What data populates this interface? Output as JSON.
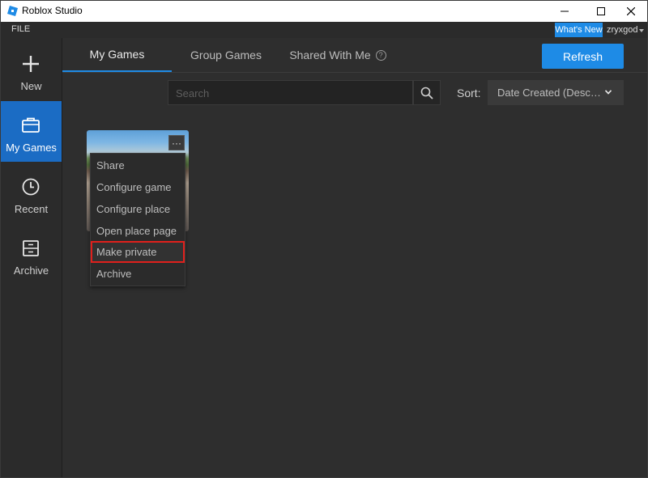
{
  "window": {
    "title": "Roblox Studio"
  },
  "menubar": {
    "file_label": "FILE",
    "whats_new_label": "What's New",
    "username": "zryxgod"
  },
  "sidebar": {
    "items": [
      {
        "label": "New"
      },
      {
        "label": "My Games"
      },
      {
        "label": "Recent"
      },
      {
        "label": "Archive"
      }
    ]
  },
  "tabs": [
    {
      "label": "My Games"
    },
    {
      "label": "Group Games"
    },
    {
      "label": "Shared With Me"
    }
  ],
  "toolbar": {
    "refresh_label": "Refresh"
  },
  "search": {
    "placeholder": "Search"
  },
  "sort": {
    "label": "Sort:",
    "selected": "Date Created (Descending)"
  },
  "card": {
    "more_label": "···"
  },
  "context_menu": {
    "items": [
      {
        "label": "Share"
      },
      {
        "label": "Configure game"
      },
      {
        "label": "Configure place"
      },
      {
        "label": "Open place page"
      },
      {
        "label": "Make private"
      },
      {
        "label": "Archive"
      }
    ]
  },
  "colors": {
    "accent": "#1e8be6",
    "selected_nav": "#1b6cc4",
    "highlight": "#e0201c"
  },
  "icons": {
    "logo": "roblox-logo-icon",
    "new": "plus-icon",
    "my_games": "briefcase-icon",
    "recent": "clock-icon",
    "archive": "archive-box-icon",
    "search": "search-icon",
    "help": "help-circle-icon",
    "sort": "chevron-down-icon"
  }
}
